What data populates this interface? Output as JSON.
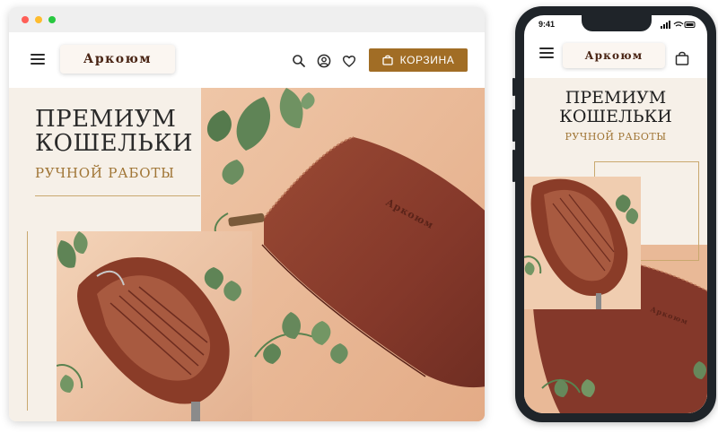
{
  "desktop": {
    "logo": "Аркоюм",
    "cart_label": "КОРЗИНА",
    "hero_title_line1": "ПРЕМИУМ",
    "hero_title_line2": "КОШЕЛЬКИ",
    "hero_subtitle": "РУЧНОЙ РАБОТЫ",
    "wallet_emboss": "Аркоюм"
  },
  "mobile": {
    "time": "9:41",
    "logo": "Аркоюм",
    "hero_title_line1": "ПРЕМИУМ",
    "hero_title_line2": "КОШЕЛЬКИ",
    "hero_subtitle": "РУЧНОЙ РАБОТЫ",
    "wallet_emboss": "Аркоюм"
  },
  "icons": {
    "menu": "hamburger-icon",
    "search": "search-icon",
    "account": "user-icon",
    "wishlist": "heart-icon",
    "cart": "shopping-bag-icon"
  },
  "colors": {
    "accent": "#a16d25",
    "leather": "#8a3c28",
    "hero_bg": "#f6f0e8",
    "peach_bg": "#e8b898"
  }
}
